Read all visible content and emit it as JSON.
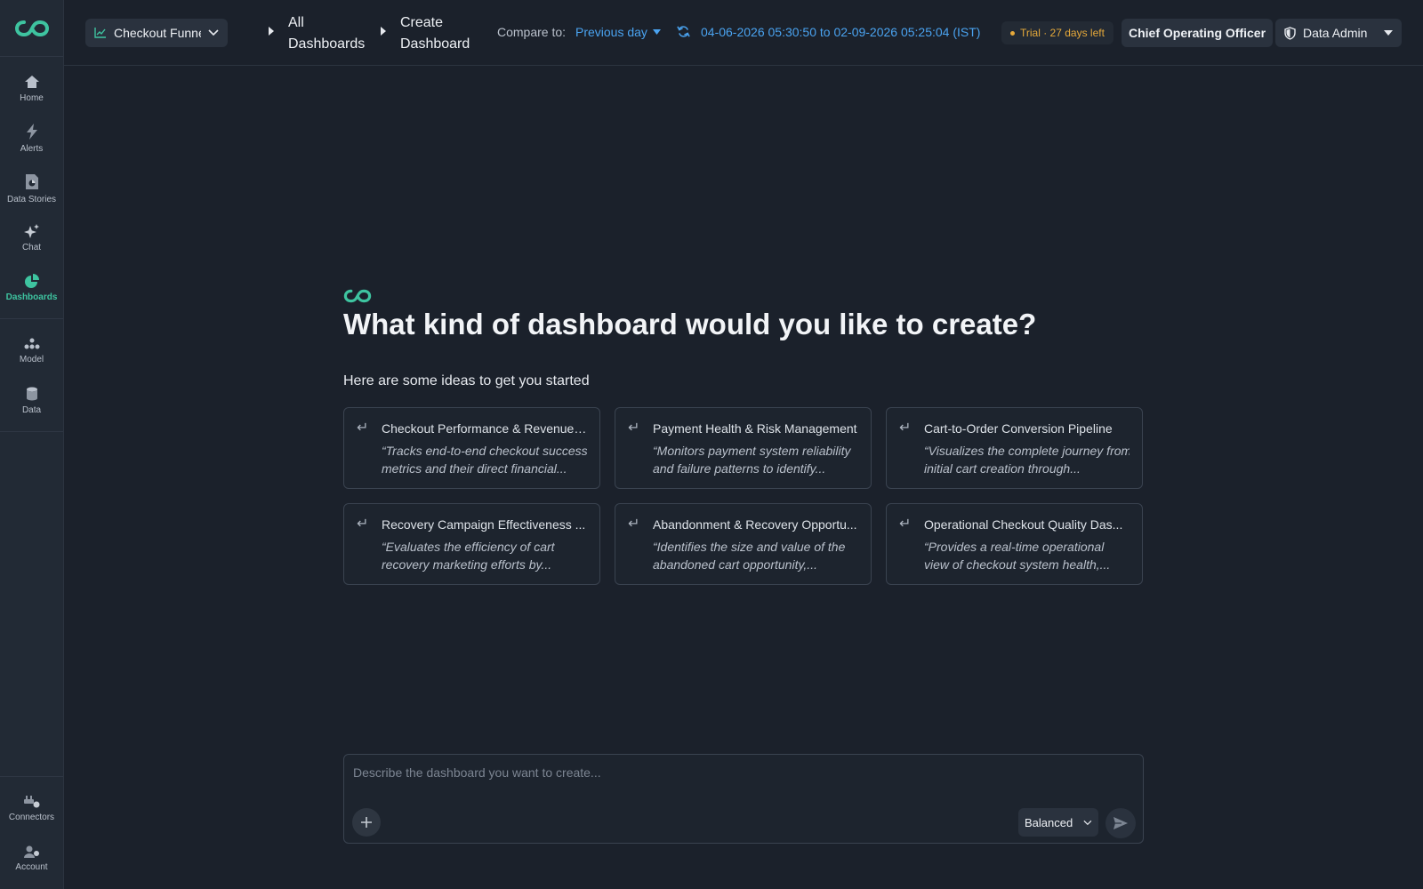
{
  "sidebar": {
    "items": [
      {
        "label": "Home",
        "icon": "home-icon"
      },
      {
        "label": "Alerts",
        "icon": "bolt-icon"
      },
      {
        "label": "Data Stories",
        "icon": "data-stories-icon"
      },
      {
        "label": "Chat",
        "icon": "sparkle-icon"
      },
      {
        "label": "Dashboards",
        "icon": "pie-chart-icon",
        "active": true
      },
      {
        "label": "Model",
        "icon": "model-icon"
      },
      {
        "label": "Data",
        "icon": "database-icon"
      }
    ],
    "bottom": [
      {
        "label": "Connectors",
        "icon": "connectors-icon"
      },
      {
        "label": "Account",
        "icon": "account-icon"
      }
    ]
  },
  "topbar": {
    "dashboard_select": "Checkout Funnel ...",
    "breadcrumb": {
      "all_line1": "All",
      "all_line2": "Dashboards",
      "create_line1": "Create",
      "create_line2": "Dashboard"
    },
    "compare_label": "Compare to:",
    "compare_value": "Previous day",
    "date_range": "04-06-2026 05:30:50 to 02-09-2026 05:25:04 (IST)",
    "trial": "Trial · 27 days left",
    "role": "Chief Operating Officer",
    "admin": "Data Admin"
  },
  "main": {
    "headline": "What kind of dashboard would you like to create?",
    "subline": "Here are some ideas to get you started",
    "cards": [
      {
        "title": "Checkout Performance & Revenue I...",
        "desc": "“Tracks end-to-end checkout success metrics and their direct financial..."
      },
      {
        "title": "Payment Health & Risk Management",
        "desc": "“Monitors payment system reliability and failure patterns to identify..."
      },
      {
        "title": "Cart-to-Order Conversion Pipeline",
        "desc": "“Visualizes the complete journey from initial cart creation through..."
      },
      {
        "title": "Recovery Campaign Effectiveness ...",
        "desc": "“Evaluates the efficiency of cart recovery marketing efforts by..."
      },
      {
        "title": "Abandonment & Recovery Opportu...",
        "desc": "“Identifies the size and value of the abandoned cart opportunity,..."
      },
      {
        "title": "Operational Checkout Quality Das...",
        "desc": "“Provides a real-time operational view of checkout system health,..."
      }
    ]
  },
  "prompt": {
    "placeholder": "Describe the dashboard you want to create...",
    "mode": "Balanced"
  },
  "colors": {
    "accent": "#3ec4a0",
    "link": "#4aa3f0",
    "trial": "#e6a93a",
    "bg": "#1b212b"
  }
}
